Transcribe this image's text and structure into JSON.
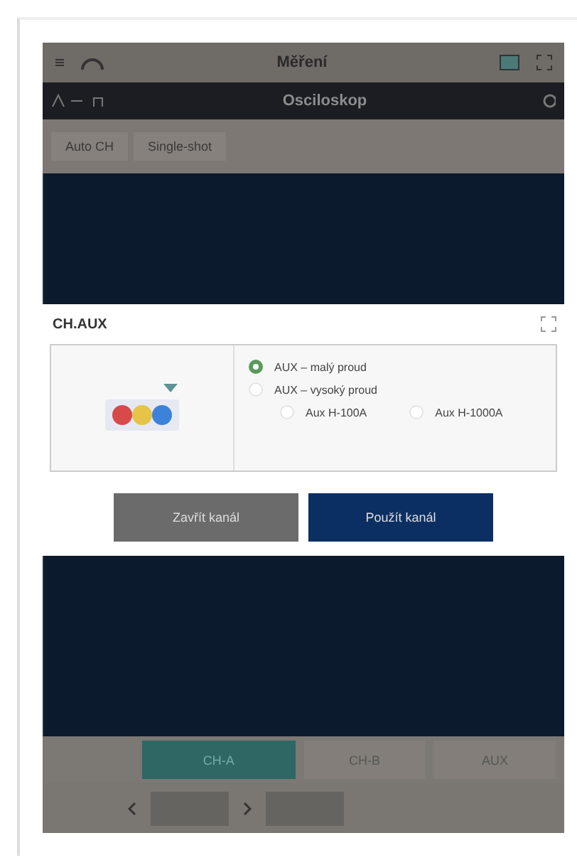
{
  "window": {
    "title": "Měření"
  },
  "header": {
    "title": "Osciloskop"
  },
  "toolbar": [
    {
      "label": "Auto CH"
    },
    {
      "label": "Single-shot"
    }
  ],
  "dialog": {
    "title": "CH.AUX",
    "options": [
      {
        "label": "AUX – malý proud",
        "selected": true
      },
      {
        "label": "AUX – vysoký proud",
        "selected": false,
        "children": [
          {
            "label": "Aux H-100A",
            "selected": false
          },
          {
            "label": "Aux H-1000A",
            "selected": false
          }
        ]
      }
    ],
    "buttons": [
      {
        "label": "Zavřít kanál",
        "kind": "secondary"
      },
      {
        "label": "Použít kanál",
        "kind": "primary"
      }
    ]
  },
  "channels": [
    {
      "label": "CH-A",
      "selected": true
    },
    {
      "label": "CH-B",
      "selected": false
    },
    {
      "label": "AUX",
      "selected": false
    }
  ]
}
